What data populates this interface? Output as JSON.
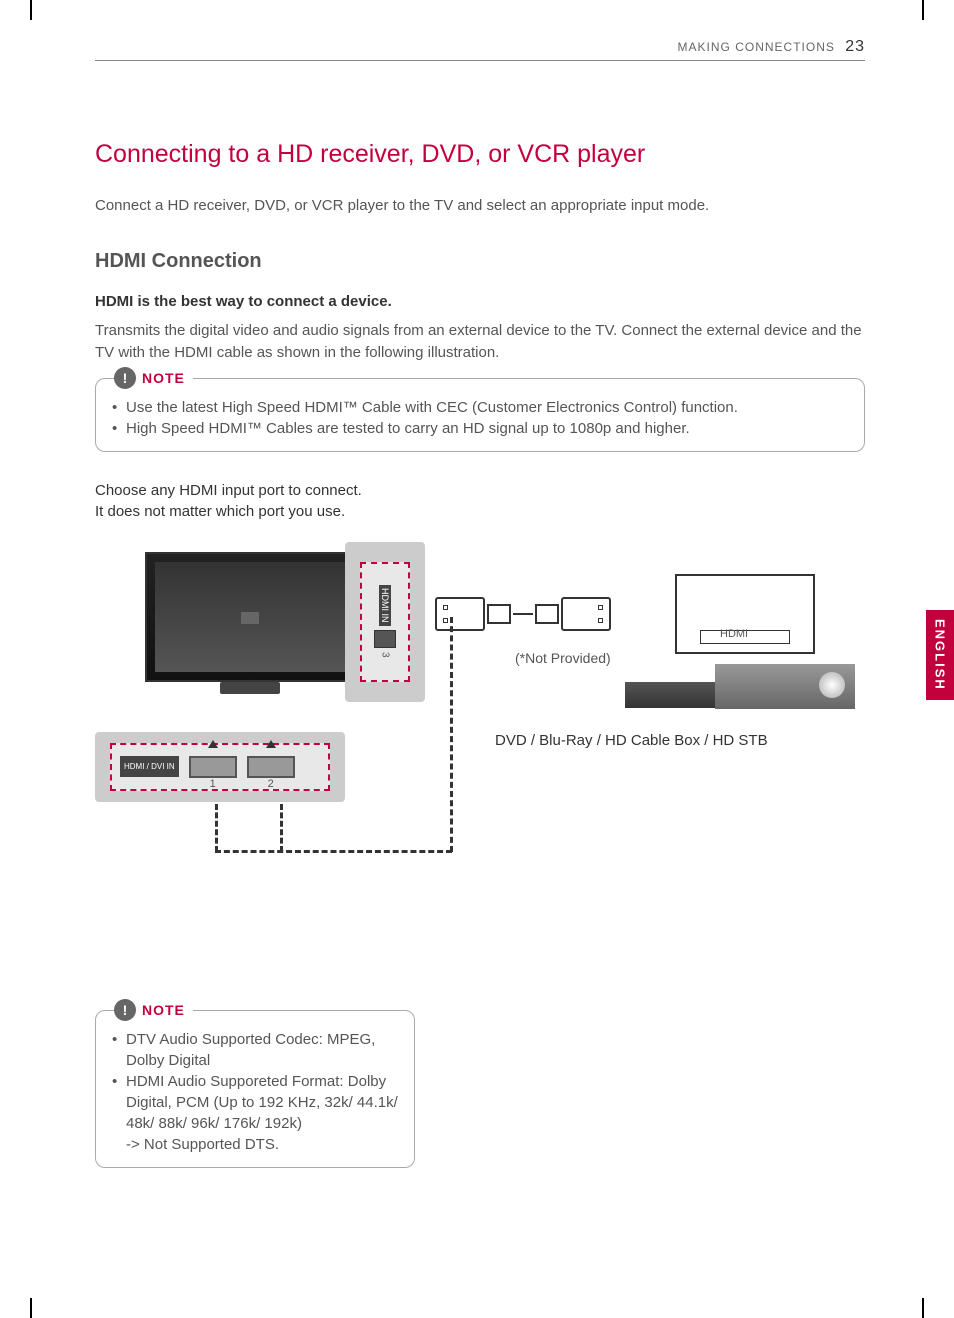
{
  "header": {
    "section": "MAKING CONNECTIONS",
    "page_number": "23"
  },
  "title": "Connecting to a HD receiver, DVD, or VCR player",
  "intro": "Connect a HD receiver, DVD, or VCR player to the TV and select an appropriate input mode.",
  "subhead": "HDMI Connection",
  "bold_line": "HDMI is the best way to connect a device.",
  "body": "Transmits the digital video and audio signals from an external device to the TV. Connect the external device and the TV with the HDMI cable as shown in the following illustration.",
  "note1": {
    "label": "NOTE",
    "items": [
      "Use the latest High Speed HDMI™ Cable with CEC (Customer Electronics Control) function.",
      "High Speed HDMI™ Cables are tested to carry an HD signal up to 1080p and higher."
    ]
  },
  "choose_text_l1": "Choose any HDMI input port to connect.",
  "choose_text_l2": "It does not matter which port you use.",
  "diagram": {
    "side_port_label": "HDMI IN",
    "side_port_num": "3",
    "bottom_port_label": "HDMI / DVI IN",
    "bottom_port_1": "1",
    "bottom_port_2": "2",
    "not_provided": "(*Not Provided)",
    "device_hdmi": "HDMI",
    "device_caption": "DVD / Blu-Ray / HD Cable Box / HD STB"
  },
  "note2": {
    "label": "NOTE",
    "items": [
      "DTV Audio Supported Codec: MPEG, Dolby Digital",
      "HDMI Audio Supporeted Format: Dolby Digital, PCM (Up to 192 KHz, 32k/ 44.1k/ 48k/ 88k/ 96k/ 176k/ 192k)"
    ],
    "item2_sub": "-> Not Supported DTS."
  },
  "lang_tab": "ENGLISH"
}
